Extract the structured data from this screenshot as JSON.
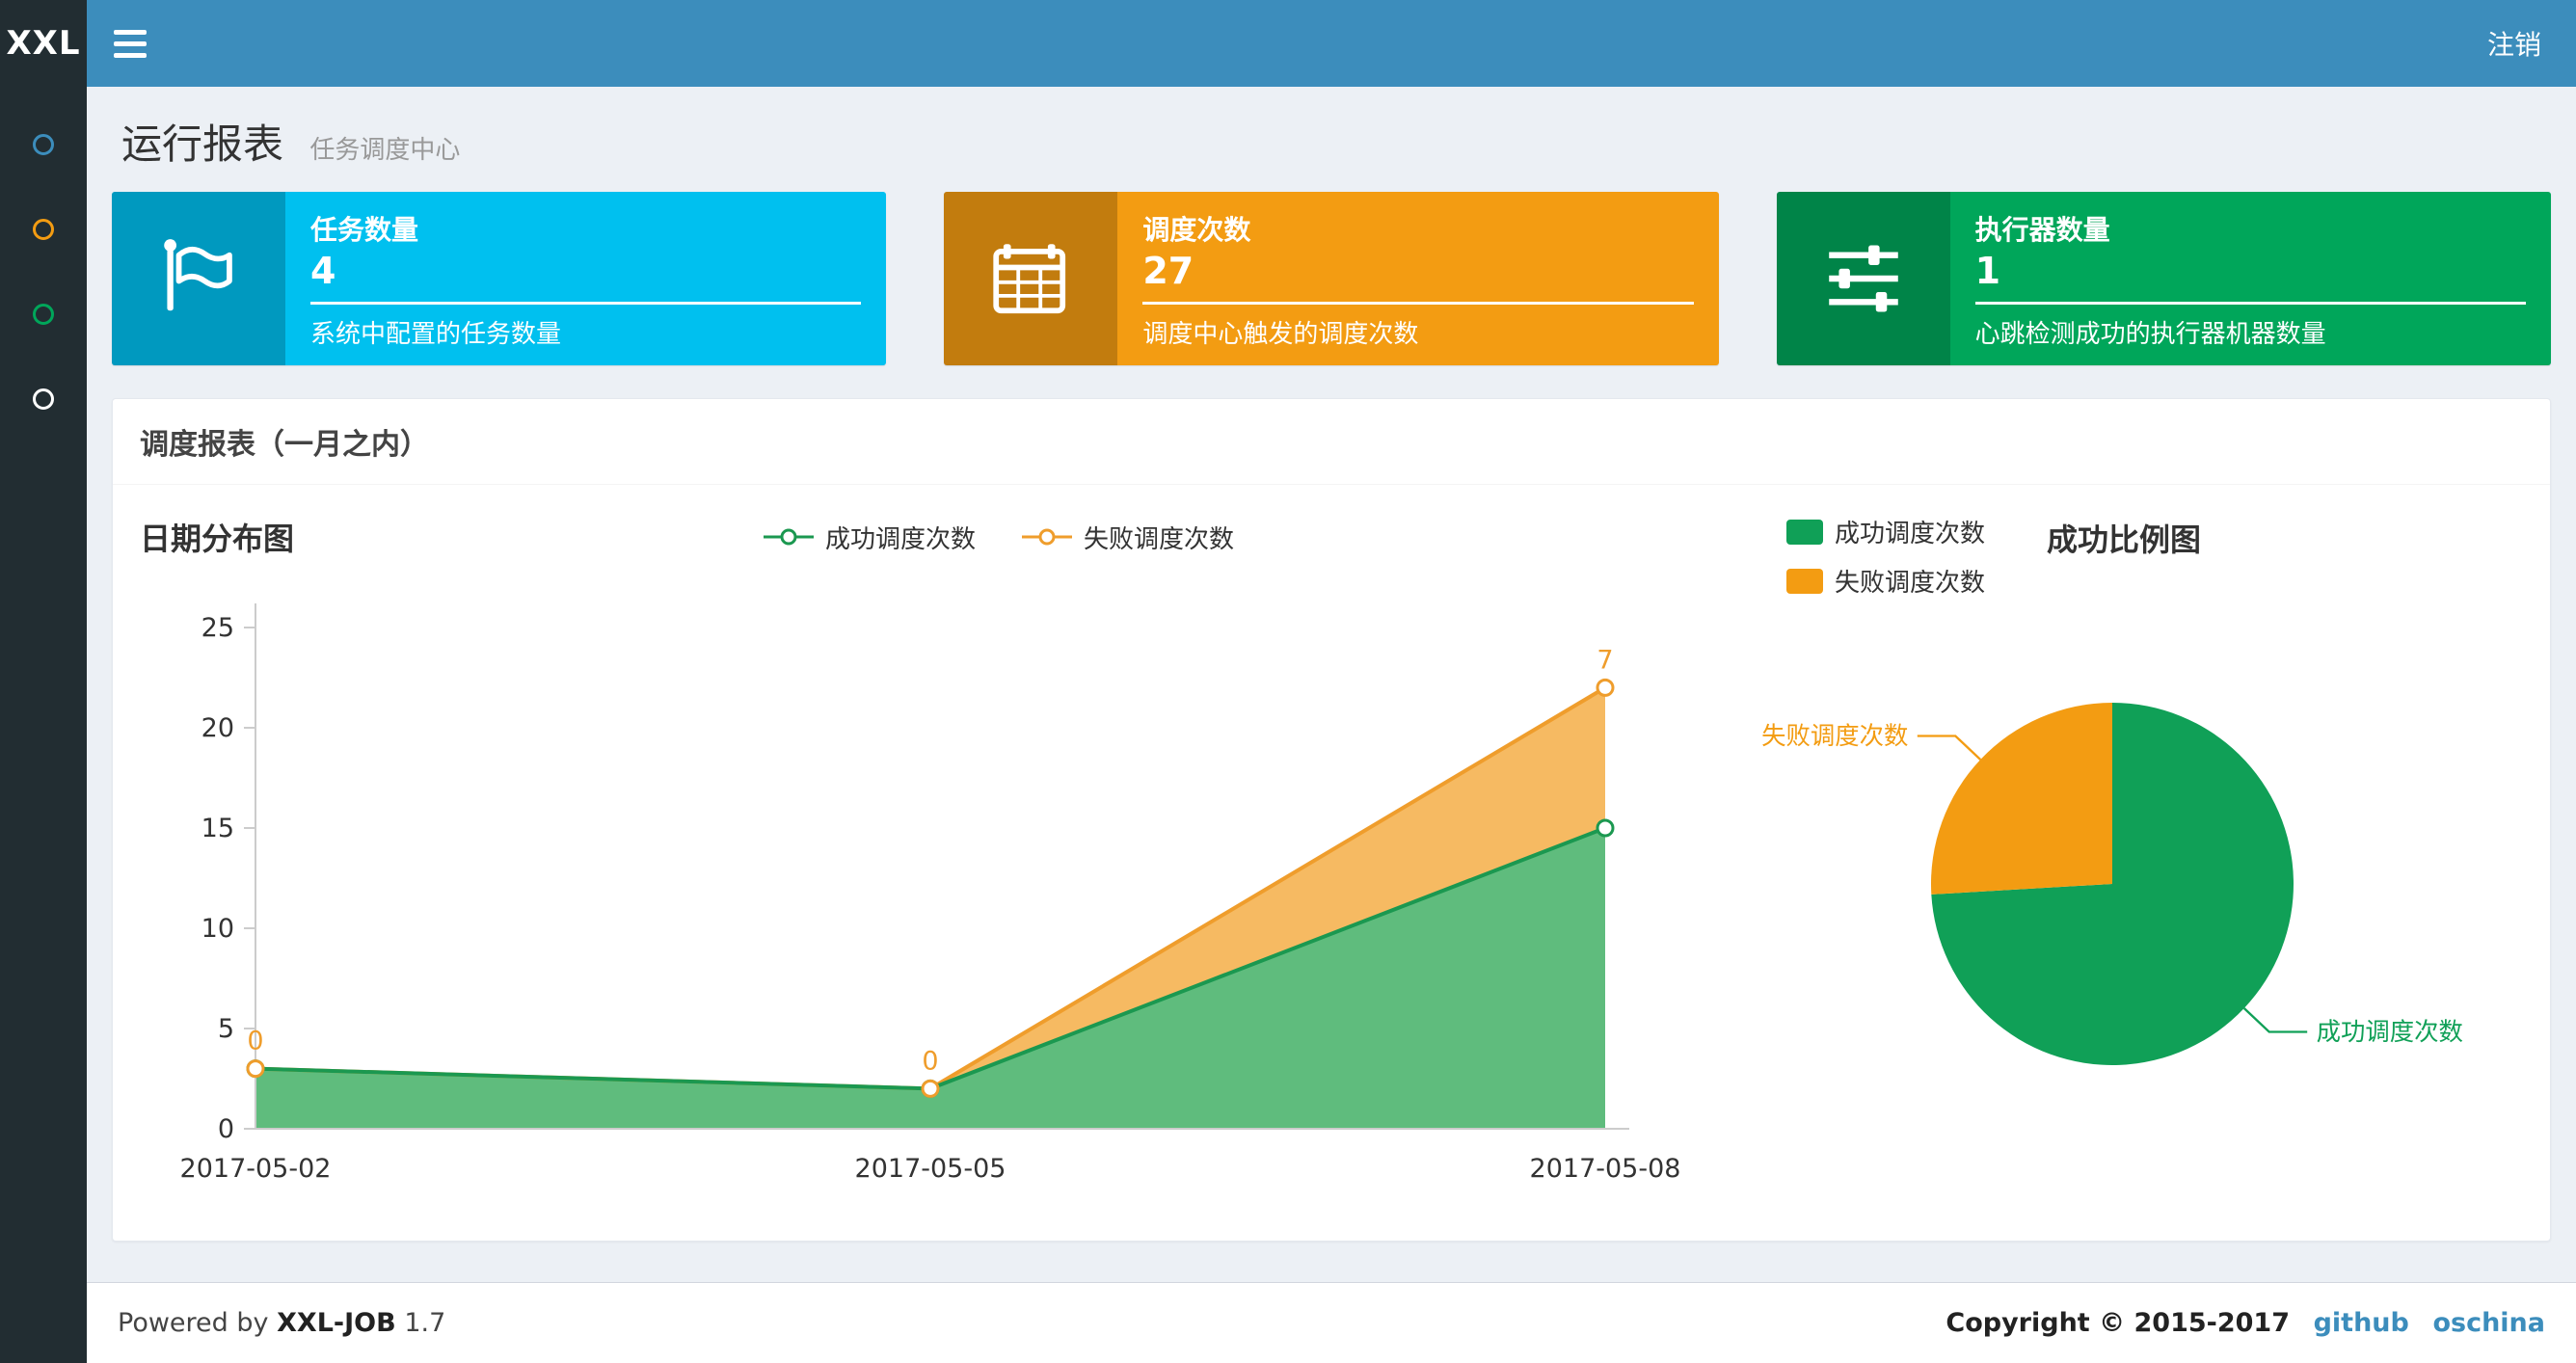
{
  "navbar": {
    "logo": "XXL",
    "logout": "注销",
    "accent_color": "#3c8dbc"
  },
  "sidebar": {
    "items": [
      {
        "icon": "circle-outline-icon",
        "color": "#3c8dbc"
      },
      {
        "icon": "circle-outline-icon",
        "color": "#f39c12"
      },
      {
        "icon": "circle-outline-icon",
        "color": "#00a65a"
      },
      {
        "icon": "circle-outline-icon",
        "color": "#ffffff"
      }
    ]
  },
  "page": {
    "title": "运行报表",
    "subtitle": "任务调度中心"
  },
  "info_boxes": [
    {
      "title": "任务数量",
      "value": "4",
      "desc": "系统中配置的任务数量",
      "color": "#00c0ef",
      "icon": "flag-icon"
    },
    {
      "title": "调度次数",
      "value": "27",
      "desc": "调度中心触发的调度次数",
      "color": "#f39c12",
      "icon": "calendar-icon"
    },
    {
      "title": "执行器数量",
      "value": "1",
      "desc": "心跳检测成功的执行器机器数量",
      "color": "#00a65a",
      "icon": "sliders-icon"
    }
  ],
  "panel": {
    "title": "调度报表（一月之内）"
  },
  "chart_data": [
    {
      "type": "area",
      "title": "日期分布图",
      "stacked": true,
      "x": [
        "2017-05-02",
        "2017-05-05",
        "2017-05-08"
      ],
      "series": [
        {
          "name": "成功调度次数",
          "values": [
            3,
            2,
            15
          ],
          "color": "#1b9850",
          "fill": "#5fbc7d"
        },
        {
          "name": "失败调度次数",
          "values": [
            0,
            0,
            7
          ],
          "color": "#ef9d2c",
          "fill": "#f6ba62",
          "show_labels": true
        }
      ],
      "ylim": [
        0,
        25
      ],
      "yticks": [
        0,
        5,
        10,
        15,
        20,
        25
      ],
      "legend_position": "top-center",
      "grid": false
    },
    {
      "type": "pie",
      "title": "成功比例图",
      "slices": [
        {
          "name": "成功调度次数",
          "value": 20,
          "color": "#10a057"
        },
        {
          "name": "失败调度次数",
          "value": 7,
          "color": "#f39c12"
        }
      ],
      "legend_position": "top-left"
    }
  ],
  "footer": {
    "powered_prefix": "Powered by",
    "brand": "XXL-JOB",
    "version": "1.7",
    "copyright": "Copyright © 2015-2017",
    "links": [
      "github",
      "oschina"
    ],
    "link_color": "#3c8dbc"
  }
}
